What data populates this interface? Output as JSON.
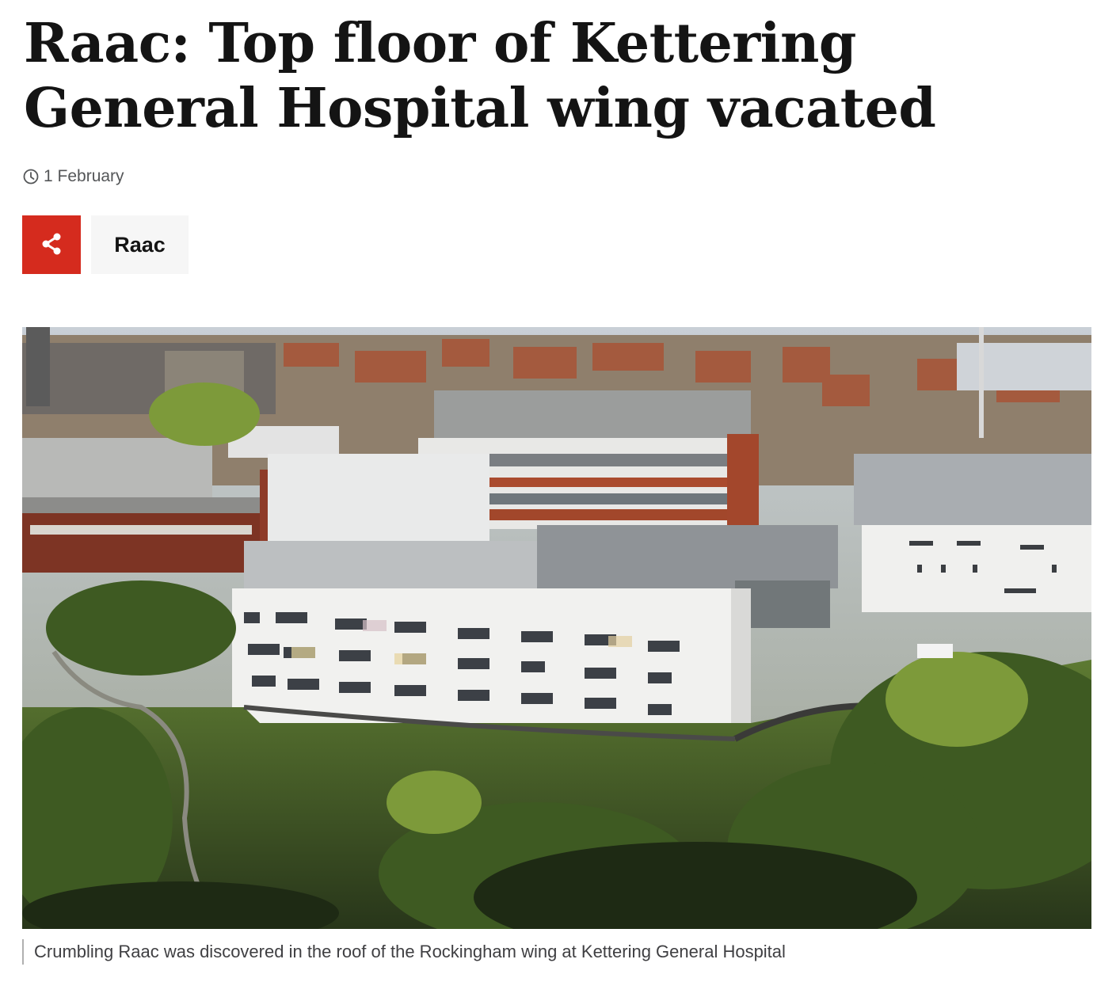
{
  "article": {
    "headline": "Raac: Top floor of Kettering General Hospital wing vacated",
    "date": "1 February",
    "tag": "Raac",
    "share_icon": "share-icon",
    "clock_icon": "clock-icon"
  },
  "image": {
    "caption": "Crumbling Raac was discovered in the roof of the Rockingham wing at Kettering General Hospital"
  },
  "colors": {
    "share_bg": "#d52b1e",
    "tag_bg": "#f6f6f6",
    "text": "#141414",
    "meta": "#545658"
  }
}
